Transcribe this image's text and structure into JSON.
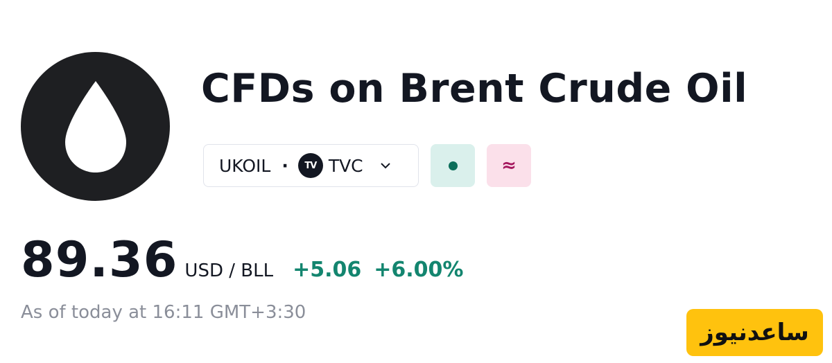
{
  "header": {
    "title": "CFDs on Brent Crude Oil",
    "logo_icon": "oil-drop-icon"
  },
  "symbol": {
    "ticker": "UKOIL",
    "separator": "·",
    "exchange_badge": "TV",
    "exchange": "TVC",
    "dropdown_icon": "chevron-down-icon"
  },
  "status": {
    "market_open_icon": "dot-icon",
    "delayed_label": "≈"
  },
  "quote": {
    "price": "89.36",
    "unit": "USD / BLL",
    "change": "+5.06",
    "change_percent": "+6.00%",
    "as_of": "As of today at 16:11 GMT+3:30"
  },
  "watermark": {
    "text": "ساعدنیوز"
  },
  "colors": {
    "positive": "#13856f",
    "open_bg": "#daf0ec",
    "delay_bg": "#fbe0ea",
    "watermark_bg": "#ffc20e"
  }
}
